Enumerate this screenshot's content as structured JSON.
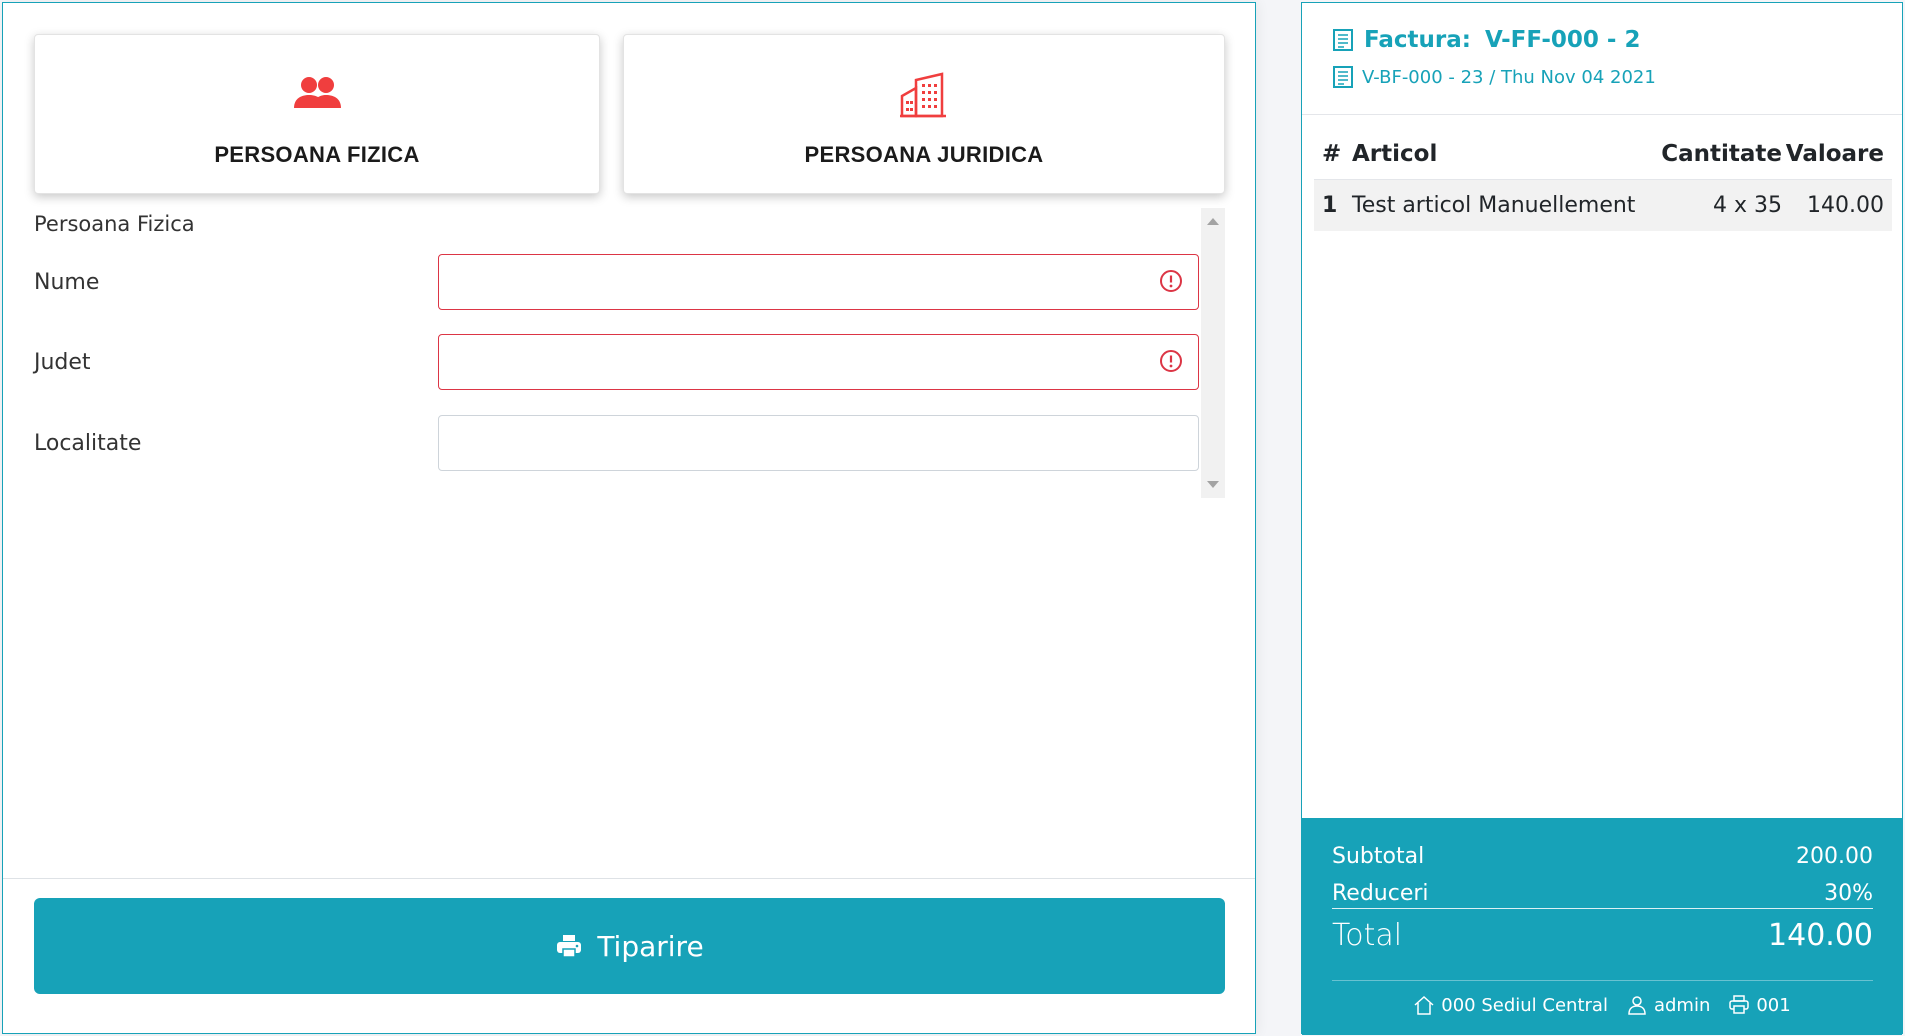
{
  "customer_types": {
    "fizica": {
      "label": "PERSOANA FIZICA",
      "icon": "users-icon"
    },
    "juridica": {
      "label": "PERSOANA JURIDICA",
      "icon": "building-icon"
    }
  },
  "form": {
    "section_title": "Persoana Fizica",
    "fields": [
      {
        "label": "Nume",
        "value": "",
        "invalid": true
      },
      {
        "label": "Judet",
        "value": "",
        "invalid": true
      },
      {
        "label": "Localitate",
        "value": "",
        "invalid": false
      }
    ]
  },
  "print_button": {
    "label": "Tiparire",
    "icon": "printer-icon"
  },
  "invoice": {
    "title_prefix": "Factura:",
    "number": "V-FF-000 - 2",
    "reference": "V-BF-000 - 23 / Thu Nov 04 2021",
    "columns": {
      "index": "#",
      "item": "Articol",
      "quantity": "Cantitate",
      "value": "Valoare"
    },
    "items": [
      {
        "index": "1",
        "name": "Test articol Manuellement",
        "quantity": "4 x 35",
        "value": "140.00"
      }
    ]
  },
  "totals": {
    "subtotal_label": "Subtotal",
    "subtotal": "200.00",
    "discount_label": "Reduceri",
    "discount": "30%",
    "total_label": "Total",
    "total": "140.00"
  },
  "status": {
    "location": "000 Sediul Central",
    "user": "admin",
    "printer": "001"
  },
  "colors": {
    "accent": "#17a2b8",
    "danger": "#dc3545",
    "icon_red": "#f03e3e"
  }
}
